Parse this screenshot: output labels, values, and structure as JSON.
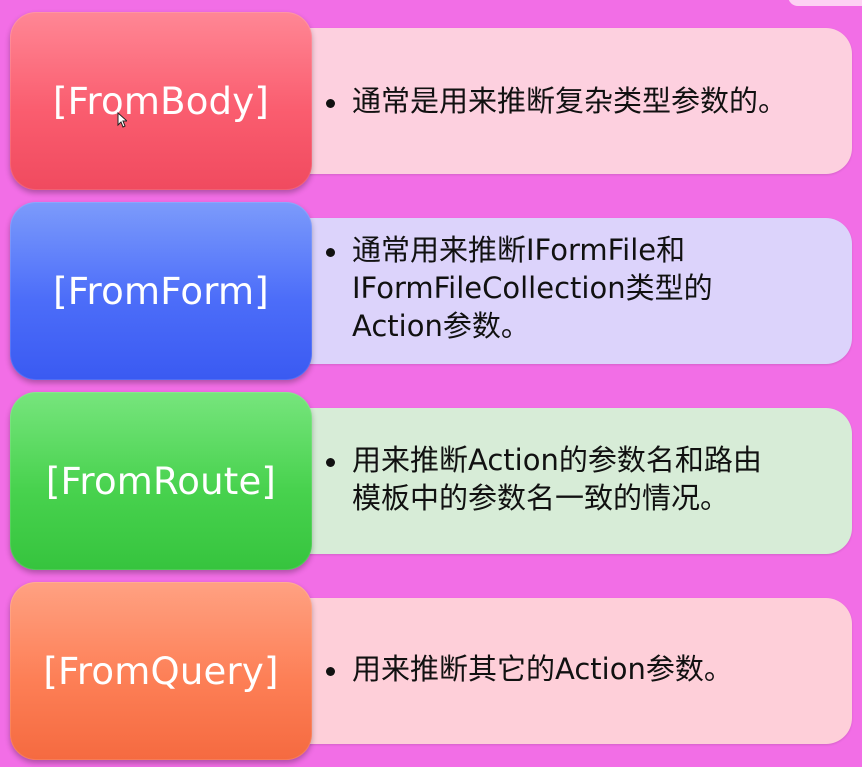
{
  "items": [
    {
      "label": "[FromBody]",
      "lines": [
        "通常是用来推断复杂类型参数的。"
      ]
    },
    {
      "label": "[FromForm]",
      "lines": [
        "通常用来推断IFormFile和",
        "IFormFileCollection类型的",
        "Action参数。"
      ]
    },
    {
      "label": "[FromRoute]",
      "lines": [
        "用来推断Action的参数名和路由",
        "模板中的参数名一致的情况。"
      ]
    },
    {
      "label": "[FromQuery]",
      "lines": [
        "用来推断其它的Action参数。"
      ]
    }
  ],
  "colors": {
    "background": "#f26ee6",
    "tile_red": "#fa5d6f",
    "tile_blue": "#4c6df9",
    "tile_green": "#48d24e",
    "tile_orange": "#fd7f56",
    "panel_pink": "#fdd0df",
    "panel_lavender": "#dcd3fb",
    "panel_green": "#d7ecd7",
    "panel_salmon": "#fecfd9"
  }
}
